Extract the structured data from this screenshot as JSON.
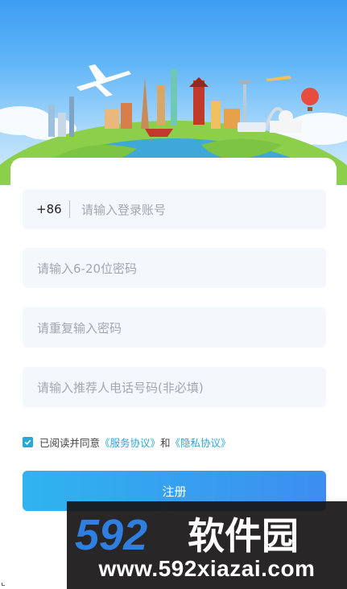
{
  "form": {
    "phone_prefix": "+86",
    "account_placeholder": "请输入登录账号",
    "password_placeholder": "请输入6-20位密码",
    "repeat_password_placeholder": "请重复输入密码",
    "referrer_placeholder": "请输入推荐人电话号码(非必填)"
  },
  "agreement": {
    "checked": true,
    "prefix": "已阅读并同意",
    "service_link": "《服务协议》",
    "conjunction": "和",
    "privacy_link": "《隐私协议》"
  },
  "register_button": {
    "label": "注册"
  },
  "watermark": {
    "brand": "592软件园",
    "url": "www.592xiazai.com"
  },
  "colors": {
    "accent": "#29a6d4",
    "button_start": "#2fb4ef",
    "button_end": "#3d8df0",
    "field_bg": "#f4f7fb"
  },
  "icons": {
    "checkbox": "check-icon"
  }
}
